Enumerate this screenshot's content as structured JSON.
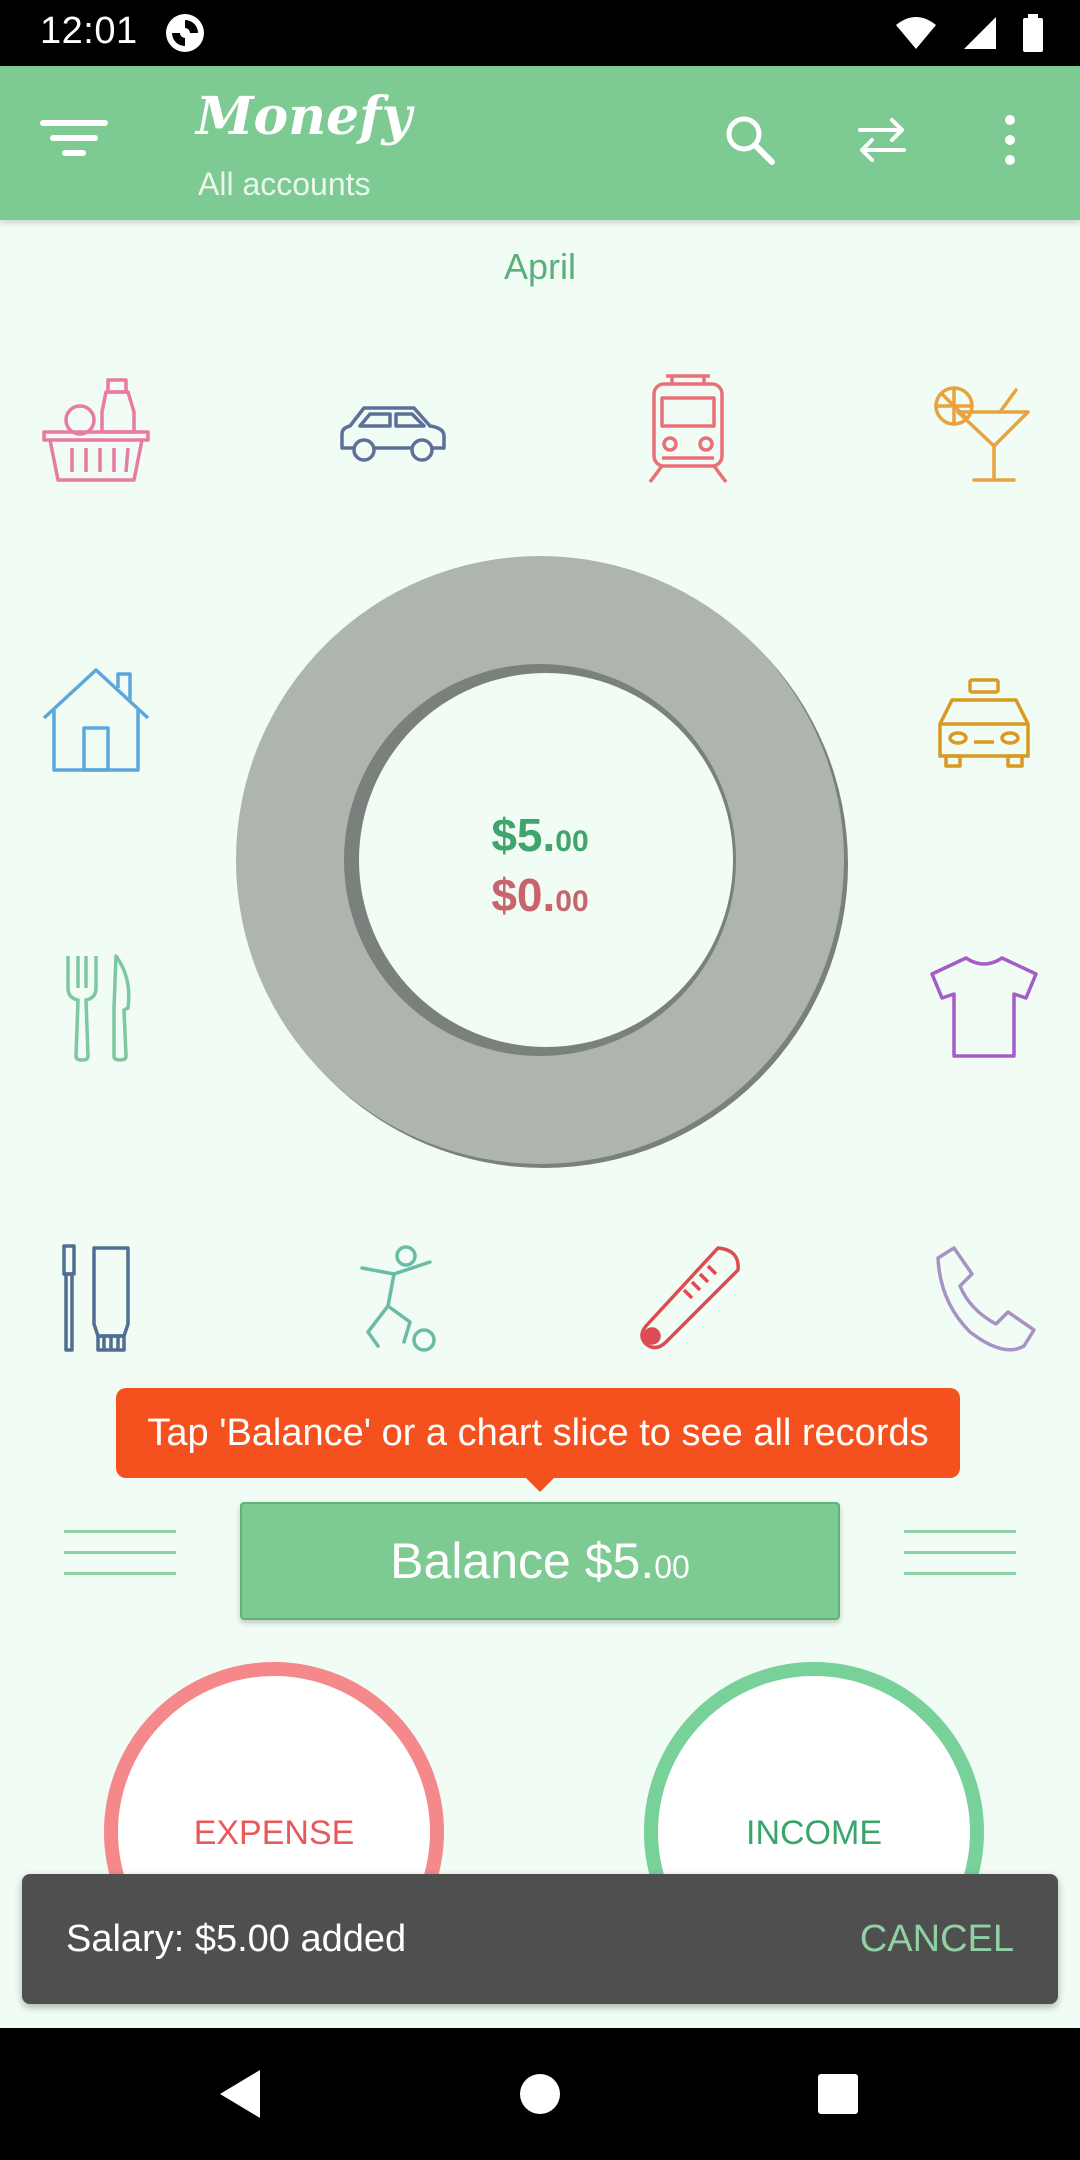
{
  "status_bar": {
    "time": "12:01"
  },
  "app_bar": {
    "title": "Monefy",
    "subtitle": "All accounts"
  },
  "period": "April",
  "categories": [
    {
      "name": "groceries",
      "color": "#E97BA3"
    },
    {
      "name": "car",
      "color": "#5E7099"
    },
    {
      "name": "transport",
      "color": "#E9707A"
    },
    {
      "name": "entertainment",
      "color": "#E8A23E"
    },
    {
      "name": "house",
      "color": "#5CA7DC"
    },
    {
      "name": "taxi",
      "color": "#D89A22"
    },
    {
      "name": "eating-out",
      "color": "#7DC8A0"
    },
    {
      "name": "clothes",
      "color": "#A55CC8"
    },
    {
      "name": "toiletry",
      "color": "#516E92"
    },
    {
      "name": "sports",
      "color": "#6BBBA5"
    },
    {
      "name": "health",
      "color": "#DD4B53"
    },
    {
      "name": "communications",
      "color": "#A792C5"
    }
  ],
  "summary": {
    "income_main": "$5.",
    "income_cents": "00",
    "expense_main": "$0.",
    "expense_cents": "00"
  },
  "tooltip": "Tap 'Balance' or a chart slice to see all records",
  "balance": {
    "main": "Balance $5.",
    "cents": "00"
  },
  "buttons": {
    "expense": "EXPENSE",
    "income": "INCOME"
  },
  "snackbar": {
    "message": "Salary: $5.00 added",
    "action": "CANCEL"
  },
  "colors": {
    "primary": "#7ECA93",
    "expense": "#F5888A",
    "income": "#77D198",
    "tooltip": "#F4511E",
    "ring": "#AEB5AF"
  }
}
